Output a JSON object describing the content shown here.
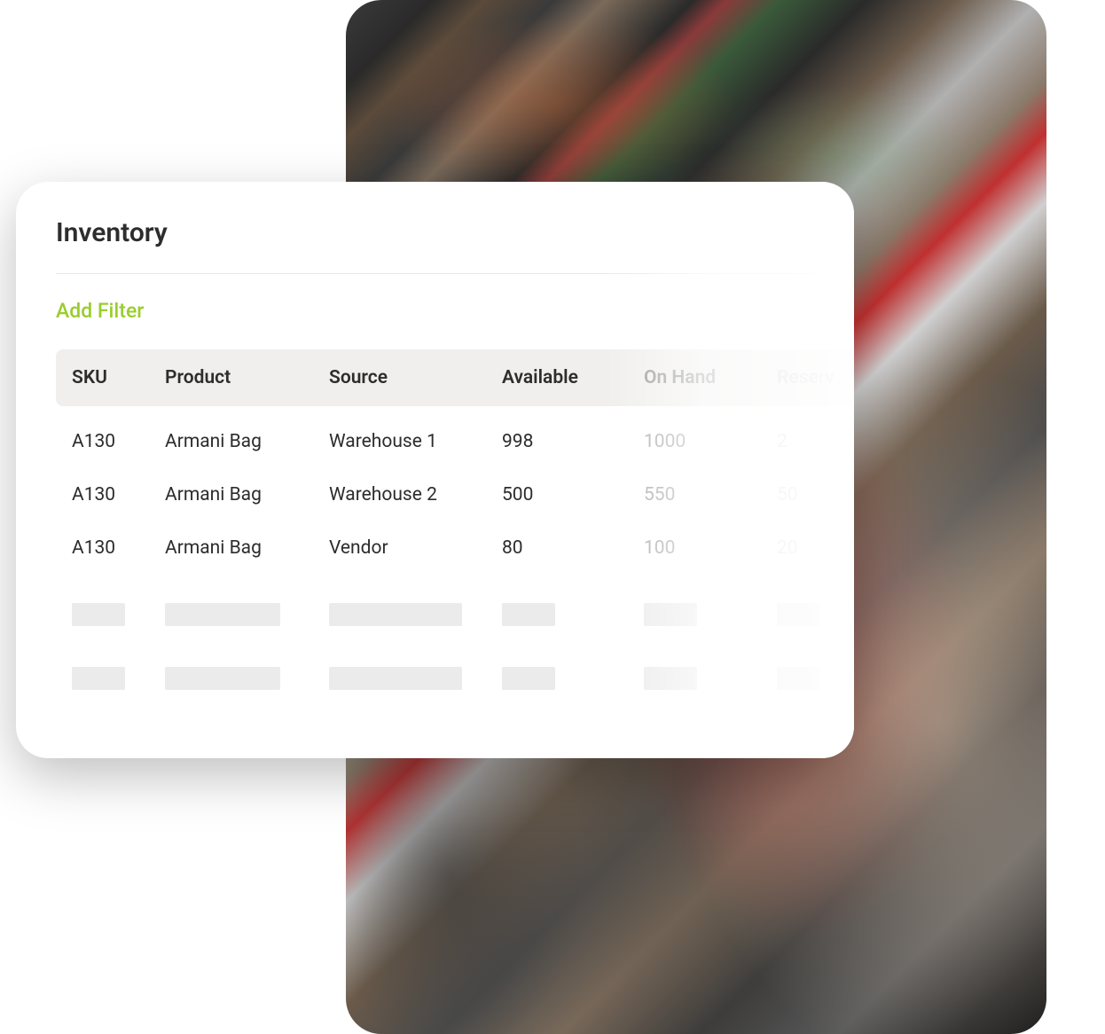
{
  "card": {
    "title": "Inventory",
    "add_filter_label": "Add Filter"
  },
  "table": {
    "columns": {
      "sku": "SKU",
      "product": "Product",
      "source": "Source",
      "available": "Available",
      "on_hand": "On Hand",
      "reserved": "Reserv"
    },
    "rows": [
      {
        "sku": "A130",
        "product": "Armani Bag",
        "source": "Warehouse 1",
        "available": "998",
        "on_hand": "1000",
        "reserved": "2"
      },
      {
        "sku": "A130",
        "product": "Armani Bag",
        "source": "Warehouse 2",
        "available": "500",
        "on_hand": "550",
        "reserved": "50"
      },
      {
        "sku": "A130",
        "product": "Armani Bag",
        "source": "Vendor",
        "available": "80",
        "on_hand": "100",
        "reserved": "20"
      }
    ]
  }
}
